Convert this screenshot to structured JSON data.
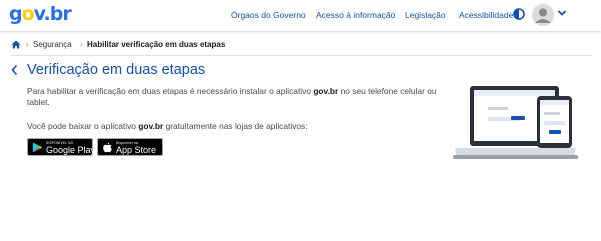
{
  "header": {
    "logo": {
      "g": "g",
      "o": "o",
      "v": "v",
      "dot": ".",
      "br": "br"
    },
    "nav": [
      "Órgaos do Governo",
      "Acesso à informação",
      "Legislação",
      "Acessibilidade"
    ],
    "icons": {
      "contrast": "contrast-icon",
      "avatar": "user-avatar-icon",
      "menu": "chevron-down-icon"
    }
  },
  "breadcrumb": {
    "home_icon": "home-icon",
    "items": [
      "Segurança",
      "Habilitar verificação em duas etapas"
    ]
  },
  "main": {
    "title": "Verificação em duas etapas",
    "desc1_pre": "Para habilitar a verificação em duas etapas é necessário instalar o aplicativo ",
    "desc1_brand": "gov.br",
    "desc1_post": " no seu telefone celular ou tablet.",
    "desc2_pre": "Você pode baixar o aplicativo ",
    "desc2_brand": "gov.br",
    "desc2_post": " gratuitamente nas lojas de aplicativos:",
    "google_play": {
      "small": "DISPONÍVEL NO",
      "big": "Google Play"
    },
    "app_store": {
      "small": "Disponível na",
      "big": "App Store"
    }
  },
  "colors": {
    "primary": "#1351b4",
    "logo_blue": "#2670e8",
    "logo_yellow": "#ffcd07"
  }
}
